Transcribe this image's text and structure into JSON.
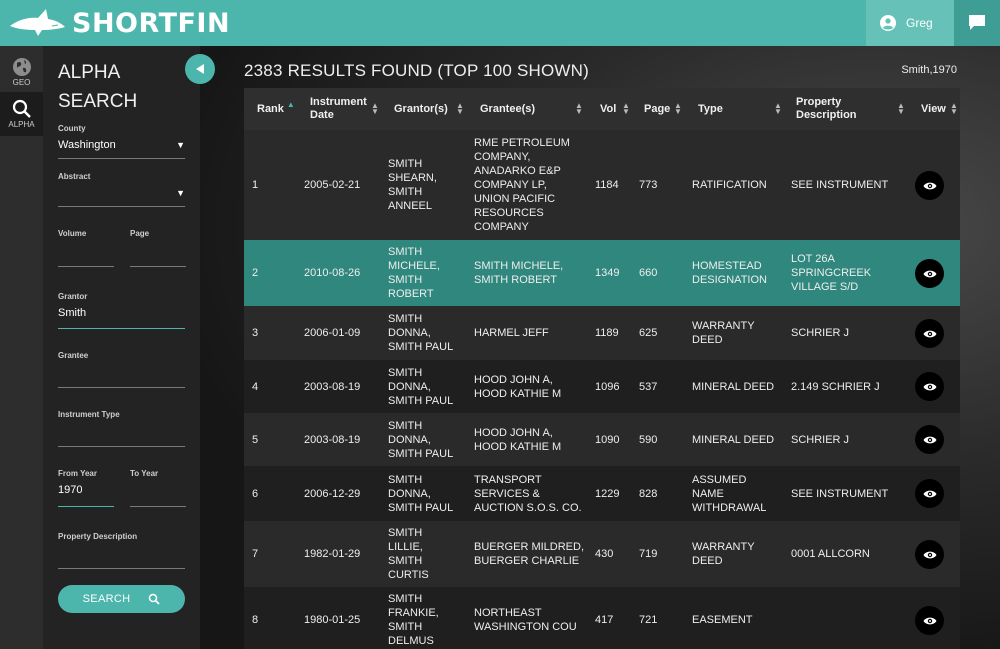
{
  "brand": {
    "name": "SHORTFIN"
  },
  "user": {
    "name": "Greg"
  },
  "rail": {
    "geo_label": "GEO",
    "alpha_label": "ALPHA"
  },
  "panel": {
    "title_line1": "ALPHA",
    "title_line2": "SEARCH",
    "fields": {
      "county": {
        "label": "County",
        "value": "Washington"
      },
      "abstract": {
        "label": "Abstract",
        "value": ""
      },
      "volume": {
        "label": "Volume",
        "value": ""
      },
      "page": {
        "label": "Page",
        "value": ""
      },
      "grantor": {
        "label": "Grantor",
        "value": "Smith"
      },
      "grantee": {
        "label": "Grantee",
        "value": ""
      },
      "instrument_type": {
        "label": "Instrument Type",
        "value": ""
      },
      "from_year": {
        "label": "From Year",
        "value": "1970"
      },
      "to_year": {
        "label": "To Year",
        "value": ""
      },
      "property_description": {
        "label": "Property Description",
        "value": ""
      }
    },
    "search_label": "SEARCH"
  },
  "results": {
    "count": "2383",
    "title_rest": "RESULTS FOUND (TOP 100 SHOWN)",
    "query": "Smith,1970"
  },
  "table": {
    "headers": {
      "rank": "Rank",
      "date_l1": "Instrument",
      "date_l2": "Date",
      "grantor": "Grantor(s)",
      "grantee": "Grantee(s)",
      "vol": "Vol",
      "page": "Page",
      "type": "Type",
      "prop_l1": "Property",
      "prop_l2": "Description",
      "view": "View"
    },
    "rows": [
      {
        "rank": "1",
        "date": "2005-02-21",
        "grantor": [
          "SMITH",
          "SHEARN,",
          "SMITH",
          "ANNEEL"
        ],
        "grantee": [
          "RME PETROLEUM",
          "COMPANY,",
          "ANADARKO E&P",
          "COMPANY LP,",
          "UNION PACIFIC",
          "RESOURCES",
          "COMPANY"
        ],
        "vol": "1184",
        "page": "773",
        "type": [
          "RATIFICATION"
        ],
        "property": [
          "SEE INSTRUMENT"
        ]
      },
      {
        "rank": "2",
        "date": "2010-08-26",
        "grantor": [
          "SMITH",
          "MICHELE,",
          "SMITH",
          "ROBERT"
        ],
        "grantee": [
          "SMITH MICHELE,",
          "SMITH ROBERT"
        ],
        "vol": "1349",
        "page": "660",
        "type": [
          "HOMESTEAD",
          "DESIGNATION"
        ],
        "property": [
          "LOT 26A",
          "SPRINGCREEK",
          "VILLAGE S/D"
        ]
      },
      {
        "rank": "3",
        "date": "2006-01-09",
        "grantor": [
          "SMITH",
          "DONNA,",
          "SMITH PAUL"
        ],
        "grantee": [
          "HARMEL JEFF"
        ],
        "vol": "1189",
        "page": "625",
        "type": [
          "WARRANTY",
          "DEED"
        ],
        "property": [
          "SCHRIER J"
        ]
      },
      {
        "rank": "4",
        "date": "2003-08-19",
        "grantor": [
          "SMITH",
          "DONNA,",
          "SMITH PAUL"
        ],
        "grantee": [
          "HOOD JOHN A,",
          "HOOD KATHIE M"
        ],
        "vol": "1096",
        "page": "537",
        "type": [
          "MINERAL DEED"
        ],
        "property": [
          "2.149 SCHRIER J"
        ]
      },
      {
        "rank": "5",
        "date": "2003-08-19",
        "grantor": [
          "SMITH",
          "DONNA,",
          "SMITH PAUL"
        ],
        "grantee": [
          "HOOD JOHN A,",
          "HOOD KATHIE M"
        ],
        "vol": "1090",
        "page": "590",
        "type": [
          "MINERAL DEED"
        ],
        "property": [
          "SCHRIER J"
        ]
      },
      {
        "rank": "6",
        "date": "2006-12-29",
        "grantor": [
          "SMITH",
          "DONNA,",
          "SMITH PAUL"
        ],
        "grantee": [
          "TRANSPORT",
          "SERVICES &",
          "AUCTION S.O.S. CO."
        ],
        "vol": "1229",
        "page": "828",
        "type": [
          "ASSUMED",
          "NAME",
          "WITHDRAWAL"
        ],
        "property": [
          "SEE INSTRUMENT"
        ]
      },
      {
        "rank": "7",
        "date": "1982-01-29",
        "grantor": [
          "SMITH",
          "LILLIE,",
          "SMITH",
          "CURTIS"
        ],
        "grantee": [
          "BUERGER MILDRED,",
          "BUERGER CHARLIE"
        ],
        "vol": "430",
        "page": "719",
        "type": [
          "WARRANTY",
          "DEED"
        ],
        "property": [
          "0001 ALLCORN"
        ]
      },
      {
        "rank": "8",
        "date": "1980-01-25",
        "grantor": [
          "SMITH",
          "FRANKIE,",
          "SMITH",
          "DELMUS"
        ],
        "grantee": [
          "NORTHEAST",
          "WASHINGTON COU"
        ],
        "vol": "417",
        "page": "721",
        "type": [
          "EASEMENT"
        ],
        "property": []
      }
    ]
  },
  "colors": {
    "accent": "#4db6ac",
    "highlight_row": "#2f877e",
    "topbar": "#4db6ac"
  }
}
